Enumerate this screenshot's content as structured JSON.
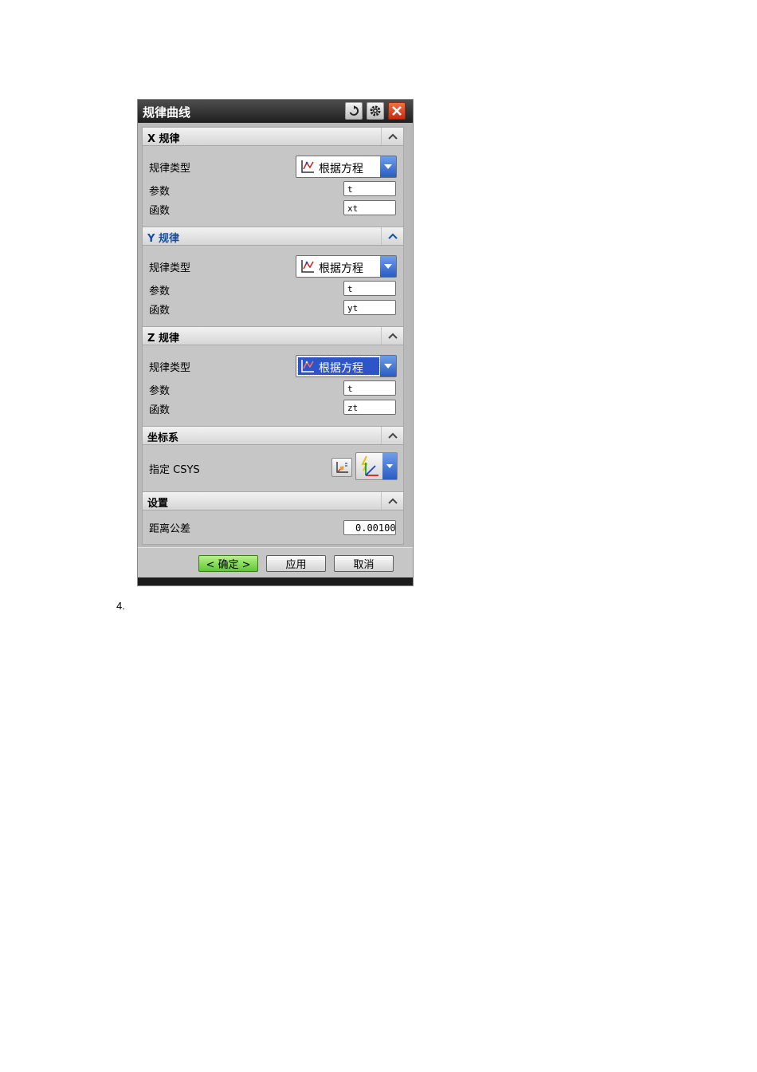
{
  "dialog": {
    "title": "规律曲线",
    "title_buttons": [
      "reset-icon",
      "gear-icon",
      "close-icon"
    ],
    "close_color": "#d8401c"
  },
  "sections": {
    "x": {
      "header": "X 规律",
      "law_type_label": "规律类型",
      "law_type_value": "根据方程",
      "param_label": "参数",
      "param_value": "t",
      "func_label": "函数",
      "func_value": "xt"
    },
    "y": {
      "header": "Y 规律",
      "law_type_label": "规律类型",
      "law_type_value": "根据方程",
      "param_label": "参数",
      "param_value": "t",
      "func_label": "函数",
      "func_value": "yt"
    },
    "z": {
      "header": "Z 规律",
      "law_type_label": "规律类型",
      "law_type_value": "根据方程",
      "param_label": "参数",
      "param_value": "t",
      "func_label": "函数",
      "func_value": "zt"
    },
    "csys": {
      "header": "坐标系",
      "specify_label": "指定 CSYS"
    },
    "settings": {
      "header": "设置",
      "tolerance_label": "距离公差",
      "tolerance_value": "0.00100"
    }
  },
  "footer": {
    "ok_label": "< 确定 >",
    "apply_label": "应用",
    "cancel_label": "取消"
  },
  "page": {
    "footnote": "4."
  },
  "colors": {
    "accent_blue": "#1250a6",
    "selection_blue": "#2e55c7",
    "ok_green": "#5ec832"
  }
}
